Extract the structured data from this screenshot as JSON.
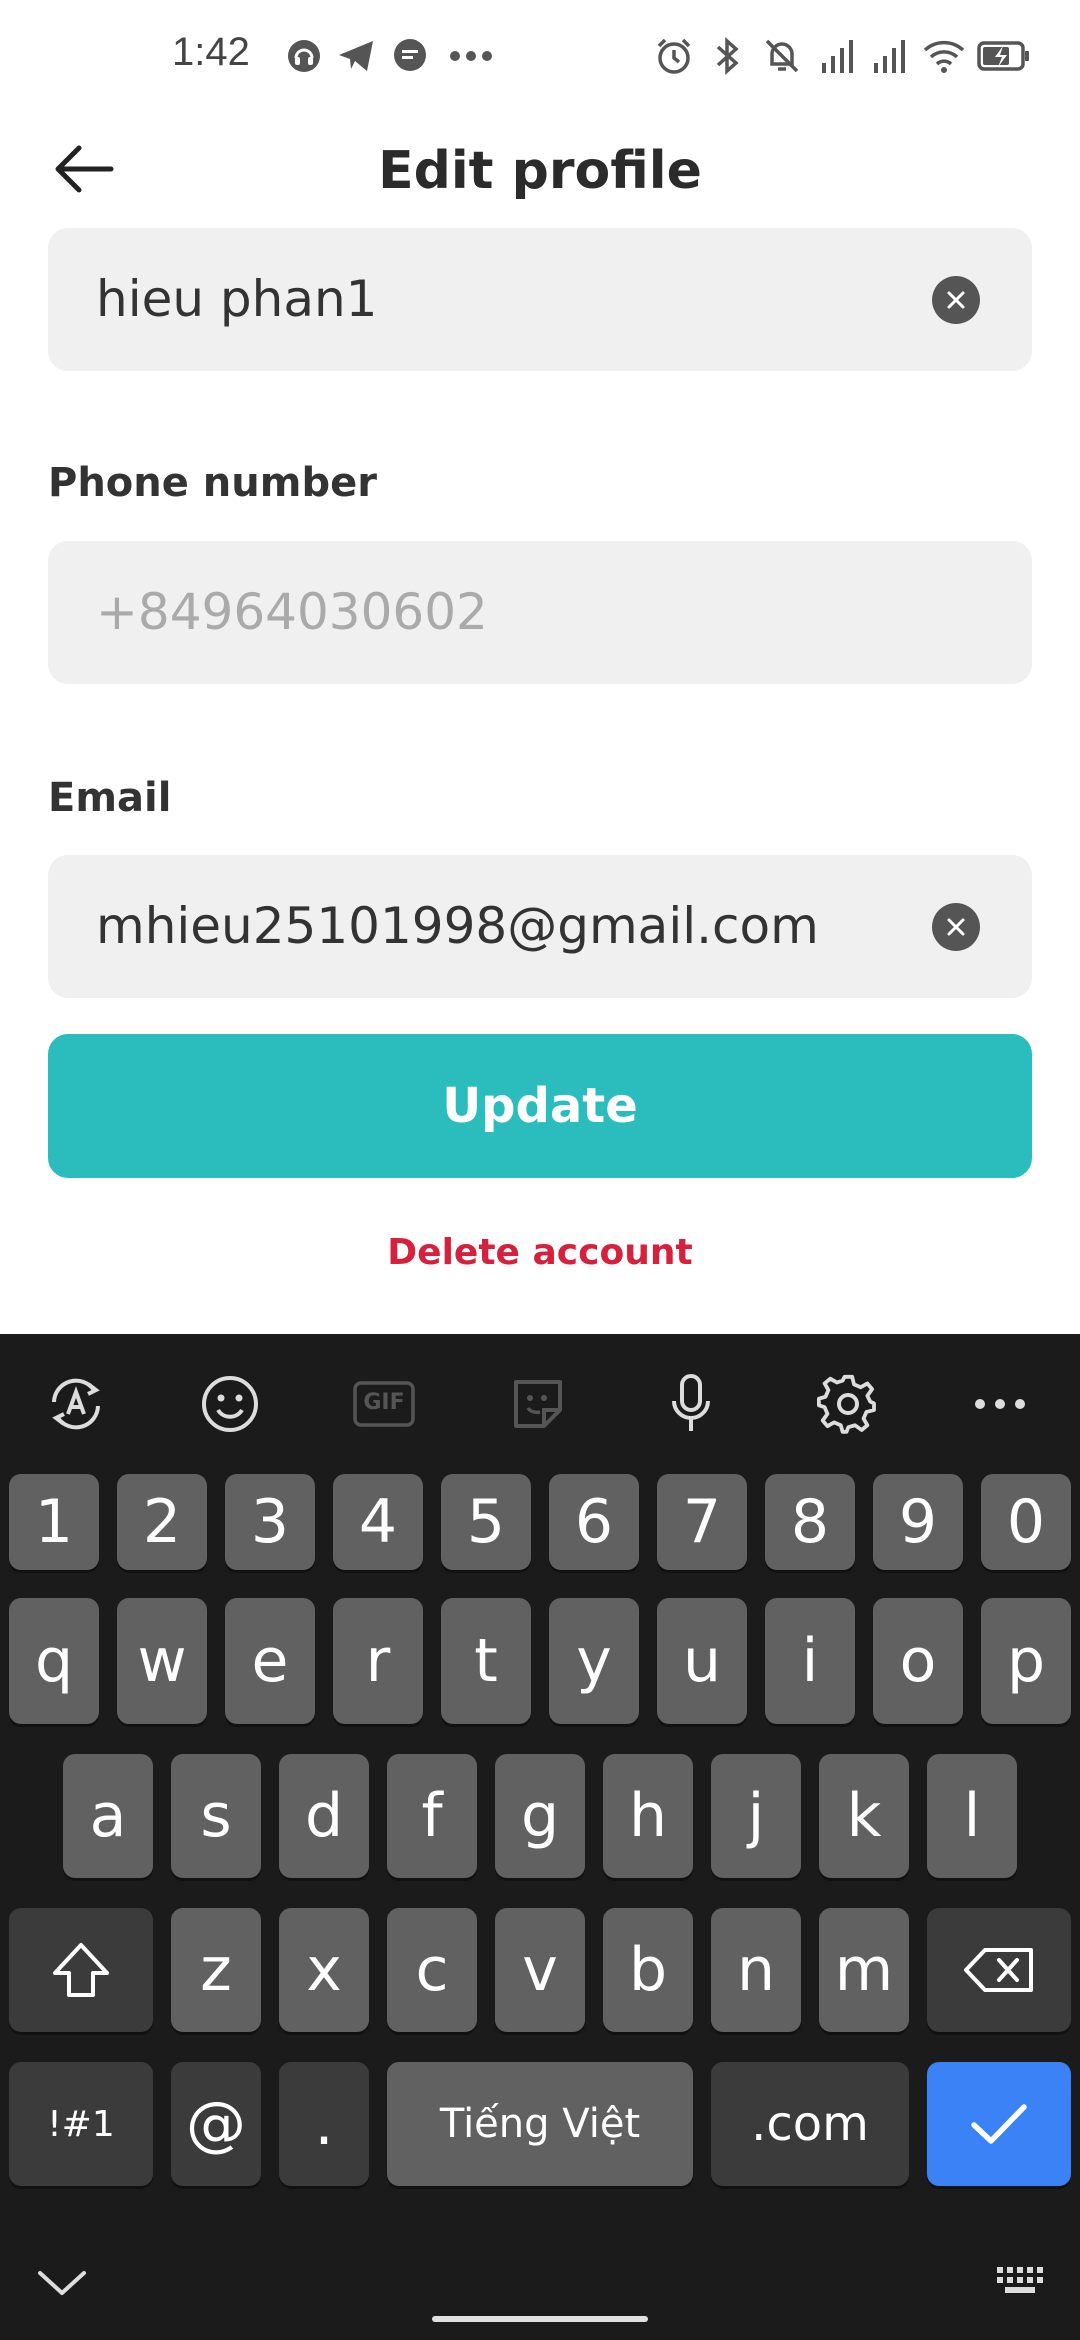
{
  "status_bar": {
    "time": "1:42",
    "left_icons": [
      "headset-icon",
      "telegram-icon",
      "chat-bubble-icon",
      "more-dots-icon"
    ],
    "right_icons": [
      "alarm-icon",
      "bluetooth-icon",
      "mute-bell-icon",
      "signal-icon",
      "signal-icon",
      "wifi-icon",
      "battery-charging-icon"
    ]
  },
  "header": {
    "title": "Edit profile",
    "back_icon": "arrow-left-icon"
  },
  "form": {
    "name_value": "hieu phan1",
    "phone_label": "Phone number",
    "phone_placeholder": "+84964030602",
    "email_label": "Email",
    "email_value": "mhieu25101998@gmail.com",
    "update_label": "Update",
    "delete_label": "Delete account"
  },
  "colors": {
    "accent": "#2bbcbd",
    "danger": "#d6203d",
    "field_bg": "#f0f0f0",
    "keyboard_bg": "#1b1b1b",
    "key_bg": "#616161",
    "key_dark_bg": "#3b3b3b",
    "confirm_key": "#3b82f6"
  },
  "keyboard": {
    "toolbar": [
      "text-rotate-icon",
      "emoji-icon",
      "gif-icon",
      "sticker-icon",
      "microphone-icon",
      "settings-gear-icon",
      "more-dots-icon"
    ],
    "gif_label": "GIF",
    "row_numbers": [
      "1",
      "2",
      "3",
      "4",
      "5",
      "6",
      "7",
      "8",
      "9",
      "0"
    ],
    "row1": [
      "q",
      "w",
      "e",
      "r",
      "t",
      "y",
      "u",
      "i",
      "o",
      "p"
    ],
    "row2": [
      "a",
      "s",
      "d",
      "f",
      "g",
      "h",
      "j",
      "k",
      "l"
    ],
    "row3": [
      "z",
      "x",
      "c",
      "v",
      "b",
      "n",
      "m"
    ],
    "symbols_label": "!#1",
    "at_label": "@",
    "dot_label": ".",
    "space_label": "Tiếng Việt",
    "dotcom_label": ".com"
  }
}
